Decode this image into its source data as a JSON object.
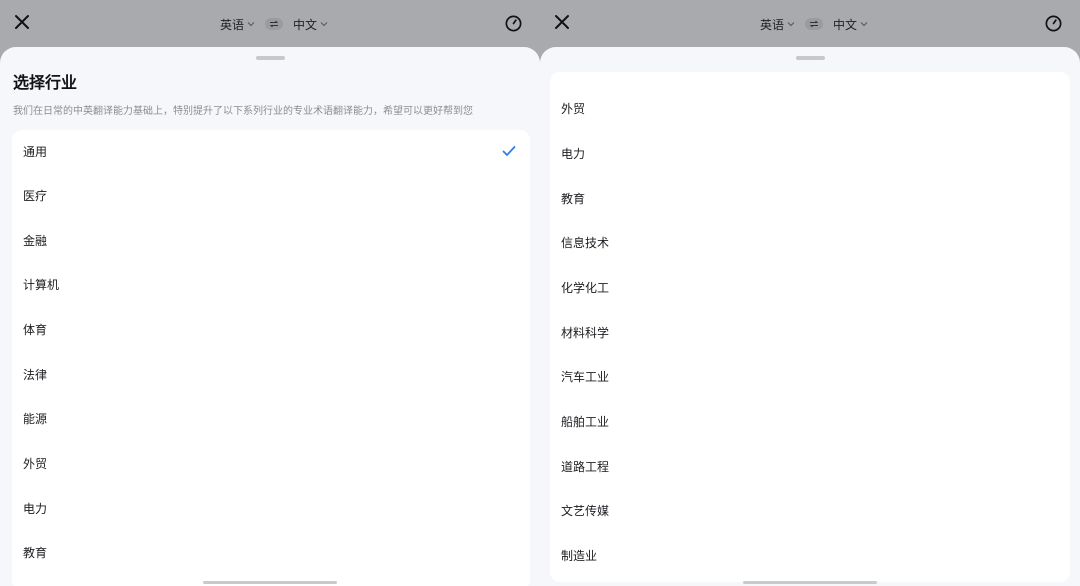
{
  "left": {
    "source_lang": "英语",
    "target_lang": "中文",
    "sheet_title": "选择行业",
    "sheet_desc": "我们在日常的中英翻译能力基础上，特别提升了以下系列行业的专业术语翻译能力，希望可以更好帮到您",
    "items": [
      "通用",
      "医疗",
      "金融",
      "计算机",
      "体育",
      "法律",
      "能源",
      "外贸",
      "电力",
      "教育"
    ],
    "selected_index": 0
  },
  "right": {
    "source_lang": "英语",
    "target_lang": "中文",
    "items": [
      "外贸",
      "电力",
      "教育",
      "信息技术",
      "化学化工",
      "材料科学",
      "汽车工业",
      "船舶工业",
      "道路工程",
      "文艺传媒",
      "制造业"
    ]
  },
  "colors": {
    "accent": "#2f7fe8",
    "overlay": "#a9aaae",
    "sheet": "#f6f7fb"
  }
}
